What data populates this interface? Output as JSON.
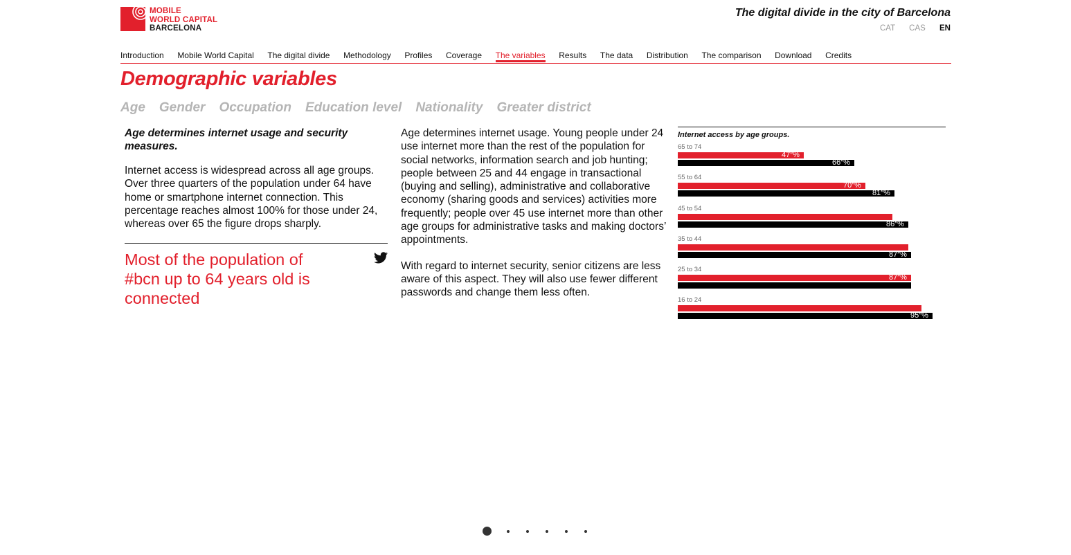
{
  "logo": {
    "line1": "MOBILE",
    "line2": "WORLD CAPITAL",
    "line3": "BARCELONA"
  },
  "header": {
    "title": "The digital divide in the city of Barcelona"
  },
  "languages": [
    {
      "label": "CAT",
      "active": false
    },
    {
      "label": "CAS",
      "active": false
    },
    {
      "label": "EN",
      "active": true
    }
  ],
  "nav": [
    "Introduction",
    "Mobile World Capital",
    "The digital divide",
    "Methodology",
    "Profiles",
    "Coverage",
    "The variables",
    "Results",
    "The data",
    "Distribution",
    "The comparison",
    "Download",
    "Credits"
  ],
  "nav_active": "The variables",
  "page": {
    "title": "Demographic variables"
  },
  "subtabs": [
    "Age",
    "Gender",
    "Occupation",
    "Education level",
    "Nationality",
    "Greater district"
  ],
  "left": {
    "lead": "Age determines internet usage and security measures.",
    "body": "Internet access is widespread across all age groups. Over three quarters of the population under 64 have home or smartphone internet connection. This percentage reaches almost 100% for those under 24, whereas over 65 the figure drops sharply.",
    "quote": "Most of the population of #bcn up to 64 years old is connected"
  },
  "middle": {
    "p1": "Age determines internet usage. Young people under 24 use internet more than the rest of the population for social networks, information search and job hunting; people between 25 and 44 engage in transactional (buying and selling), administrative and collaborative economy (sharing goods and services) activities more frequently; people over 45 use internet more than other age groups for administrative tasks and making doctors’ appointments.",
    "p2": "With regard to internet security, senior citizens are less aware of this aspect. They will also use fewer different passwords and change them less often."
  },
  "colors": {
    "accent": "#e2202c",
    "secondary": "#000000"
  },
  "chart_data": {
    "type": "bar",
    "orientation": "horizontal",
    "title": "Internet access by age groups.",
    "categories": [
      "65 to 74",
      "55 to 64",
      "45 to 54",
      "35 to 44",
      "25 to 34",
      "16 to 24"
    ],
    "series": [
      {
        "color": "#e2202c",
        "values": [
          47,
          70,
          80,
          86,
          87,
          91
        ],
        "labels": [
          "47",
          "70",
          "",
          "",
          "87",
          ""
        ]
      },
      {
        "color": "#000000",
        "values": [
          66,
          81,
          86,
          87,
          87,
          95
        ],
        "labels": [
          "66",
          "81",
          "86",
          "87",
          "",
          "95"
        ]
      }
    ],
    "unit": "%",
    "xlim": [
      0,
      100
    ]
  },
  "pager": {
    "count": 6,
    "active": 0
  }
}
